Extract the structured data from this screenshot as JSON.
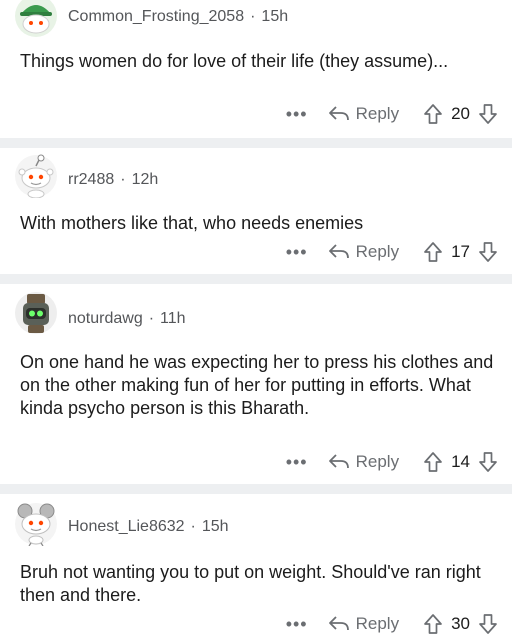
{
  "comments": [
    {
      "username": "Common_Frosting_2058",
      "age": "15h",
      "text": "Things women do for love of their life (they assume)...",
      "more": "•••",
      "reply_label": "Reply",
      "score": "20",
      "avatar": "snoo-green-cap-avatar"
    },
    {
      "username": "rr2488",
      "age": "12h",
      "text": "With mothers like that, who needs enemies",
      "more": "•••",
      "reply_label": "Reply",
      "score": "17",
      "avatar": "snoo-default-avatar"
    },
    {
      "username": "noturdawg",
      "age": "11h",
      "text": "On one hand he was expecting her to press his clothes and on the other making fun of her for putting in efforts. What kinda psycho person is this Bharath.",
      "more": "•••",
      "reply_label": "Reply",
      "score": "14",
      "avatar": "robot-avatar"
    },
    {
      "username": "Honest_Lie8632",
      "age": "15h",
      "text": "Bruh not wanting you to put on weight. Should've ran right then and there.",
      "more": "•••",
      "reply_label": "Reply",
      "score": "30",
      "avatar": "snoo-mouse-ears-avatar"
    }
  ],
  "colors": {
    "separator": "#edeff1",
    "meta": "#545659",
    "text": "#1c1c1c"
  },
  "icons": {
    "reply": "reply-arrow-icon",
    "upvote": "upvote-arrow-icon",
    "downvote": "downvote-arrow-icon"
  }
}
